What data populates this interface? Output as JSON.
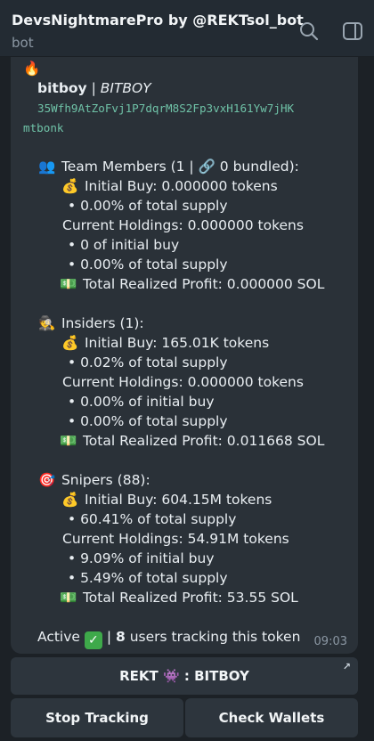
{
  "header": {
    "title": "DevsNightmarePro by @REKTsol_bot",
    "subtitle": "bot",
    "icons": [
      "search-icon",
      "side-panel-icon"
    ]
  },
  "message": {
    "fire_emoji": "🔥",
    "token_name": "bitboy",
    "separator": " | ",
    "token_symbol": "BITBOY",
    "address_line1": "35Wfh9AtZoFvj1P7dqrM8S2Fp3vxH161Yw7jHK",
    "address_line2": "mtbonk",
    "team": {
      "emoji": "👥",
      "header": "Team Members (1 | 🔗 0 bundled):",
      "initial_buy": "Initial Buy: 0.000000 tokens",
      "initial_pct": "• 0.00% of total supply",
      "holdings": "Current Holdings: 0.000000 tokens",
      "holdings_of_buy": "• 0 of initial buy",
      "holdings_pct": "• 0.00% of total supply",
      "profit": "Total Realized Profit: 0.000000 SOL"
    },
    "insiders": {
      "emoji": "🕵",
      "header": "Insiders (1):",
      "initial_buy": "Initial Buy: 165.01K tokens",
      "initial_pct": "• 0.02% of total supply",
      "holdings": "Current Holdings: 0.000000 tokens",
      "holdings_of_buy": "• 0.00% of initial buy",
      "holdings_pct": "• 0.00% of total supply",
      "profit": "Total Realized Profit: 0.011668 SOL"
    },
    "snipers": {
      "emoji": "🎯",
      "header": "Snipers (88):",
      "initial_buy": "Initial Buy: 604.15M tokens",
      "initial_pct": "• 60.41% of total supply",
      "holdings": "Current Holdings: 54.91M tokens",
      "holdings_of_buy": "• 9.09% of initial buy",
      "holdings_pct": "• 5.49% of total supply",
      "profit": "Total Realized Profit: 53.55 SOL"
    },
    "money_bag_emoji": "💰",
    "cash_emoji": "💵",
    "status_prefix": "Active",
    "status_check": "✓",
    "status_mid": " | ",
    "users_count": "8",
    "status_suffix": " users tracking this token",
    "time": "09:03"
  },
  "buttons": {
    "rekt": "REKT 👾 : BITBOY",
    "rekt_corner": "↗",
    "stop": "Stop Tracking",
    "check": "Check Wallets"
  },
  "colors": {
    "header_bg": "#232b33",
    "chat_bg": "#1c2126",
    "bubble_bg": "#2a3138",
    "button_bg": "#2d353d",
    "address_color": "#6fc2a7"
  }
}
